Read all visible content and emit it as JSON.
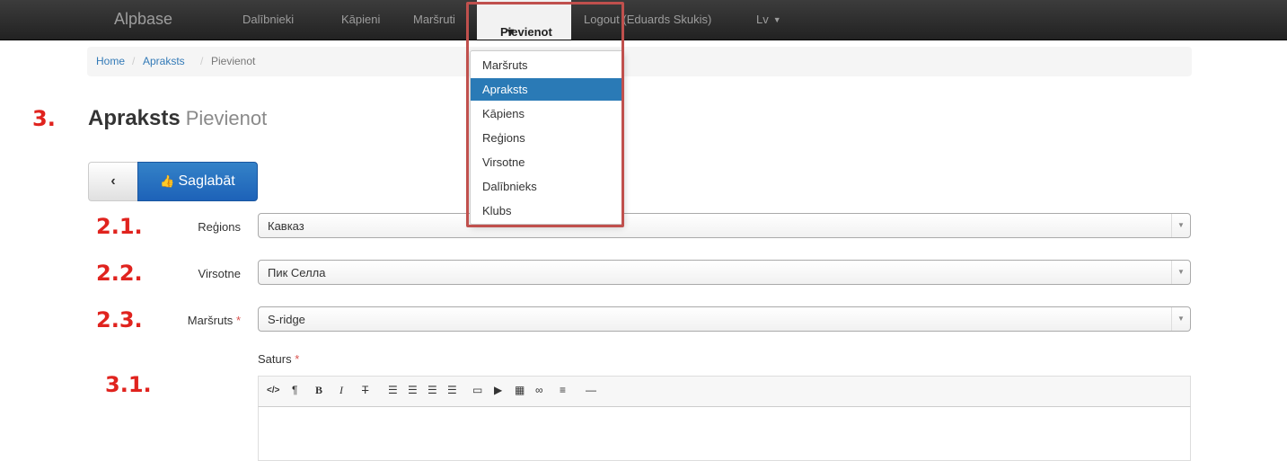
{
  "navbar": {
    "brand": "Alpbase",
    "items": [
      "Dalībnieki",
      "Kāpieni",
      "Maršruti"
    ],
    "active": "Pievienot",
    "logout": "Logout (Eduards Skukis)",
    "lang": "Lv"
  },
  "dropdown": {
    "items": [
      "Maršruts",
      "Apraksts",
      "Kāpiens",
      "Reģions",
      "Virsotne",
      "Dalībnieks",
      "Klubs"
    ],
    "selected": "Apraksts"
  },
  "breadcrumb": {
    "home": "Home",
    "section": "Apraksts",
    "current": "Pievienot",
    "sep": "/"
  },
  "page": {
    "title": "Apraksts",
    "subtitle": "Pievienot"
  },
  "buttons": {
    "back": "‹",
    "save": "Saglabāt"
  },
  "steps": {
    "title": "3.",
    "region": "2.1.",
    "peak": "2.2.",
    "route": "2.3.",
    "content": "3.1."
  },
  "form": {
    "region": {
      "label": "Reģions",
      "value": "Кавказ"
    },
    "peak": {
      "label": "Virsotne",
      "value": "Пик Селла"
    },
    "route": {
      "label": "Maršruts",
      "value": "S-ridge",
      "required": "*"
    },
    "content": {
      "label": "Saturs",
      "required": "*"
    }
  },
  "colors": {
    "annotation": "#e0231e",
    "highlight": "#c0504d",
    "primary": "#2a7ab6"
  }
}
